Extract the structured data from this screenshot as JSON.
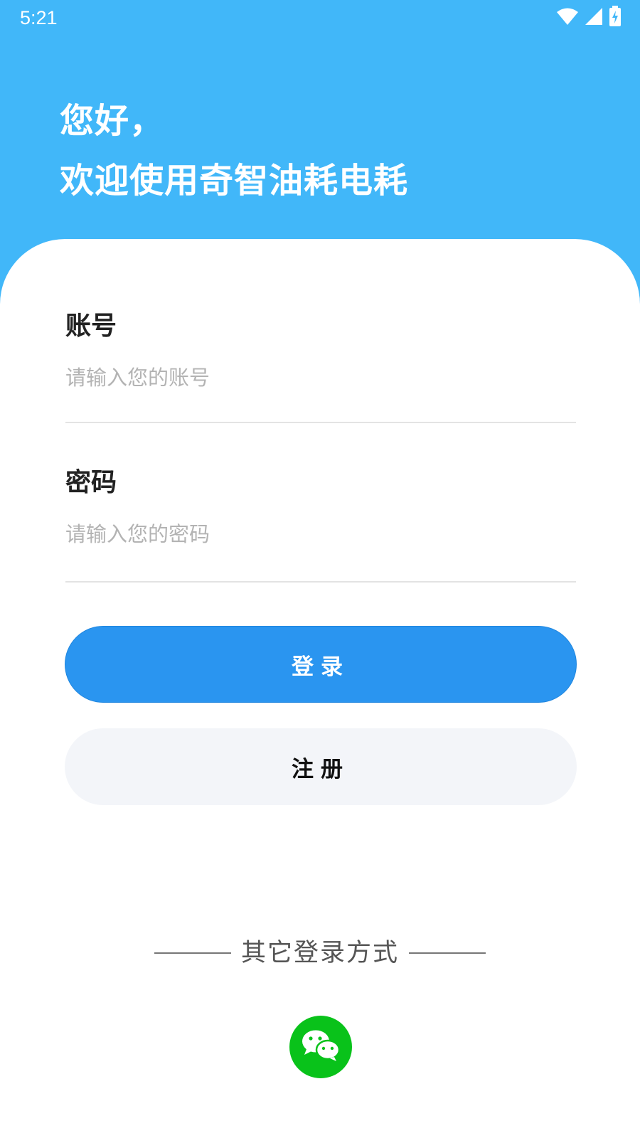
{
  "status_bar": {
    "time": "5:21",
    "icons": [
      "wifi-icon",
      "signal-icon",
      "battery-charging-icon"
    ]
  },
  "header": {
    "greeting_line1": "您好，",
    "greeting_line2": "欢迎使用奇智油耗电耗"
  },
  "form": {
    "account": {
      "label": "账号",
      "placeholder": "请输入您的账号",
      "value": ""
    },
    "password": {
      "label": "密码",
      "placeholder": "请输入您的密码",
      "value": ""
    }
  },
  "buttons": {
    "login_label": "登录",
    "register_label": "注册"
  },
  "other_login": {
    "title": "其它登录方式",
    "methods": [
      {
        "icon": "wechat-icon"
      }
    ]
  },
  "colors": {
    "header": "#41b7f9",
    "login_button": "#2a95f0",
    "register_button": "#f3f5f9",
    "wechat": "#09c21a"
  }
}
